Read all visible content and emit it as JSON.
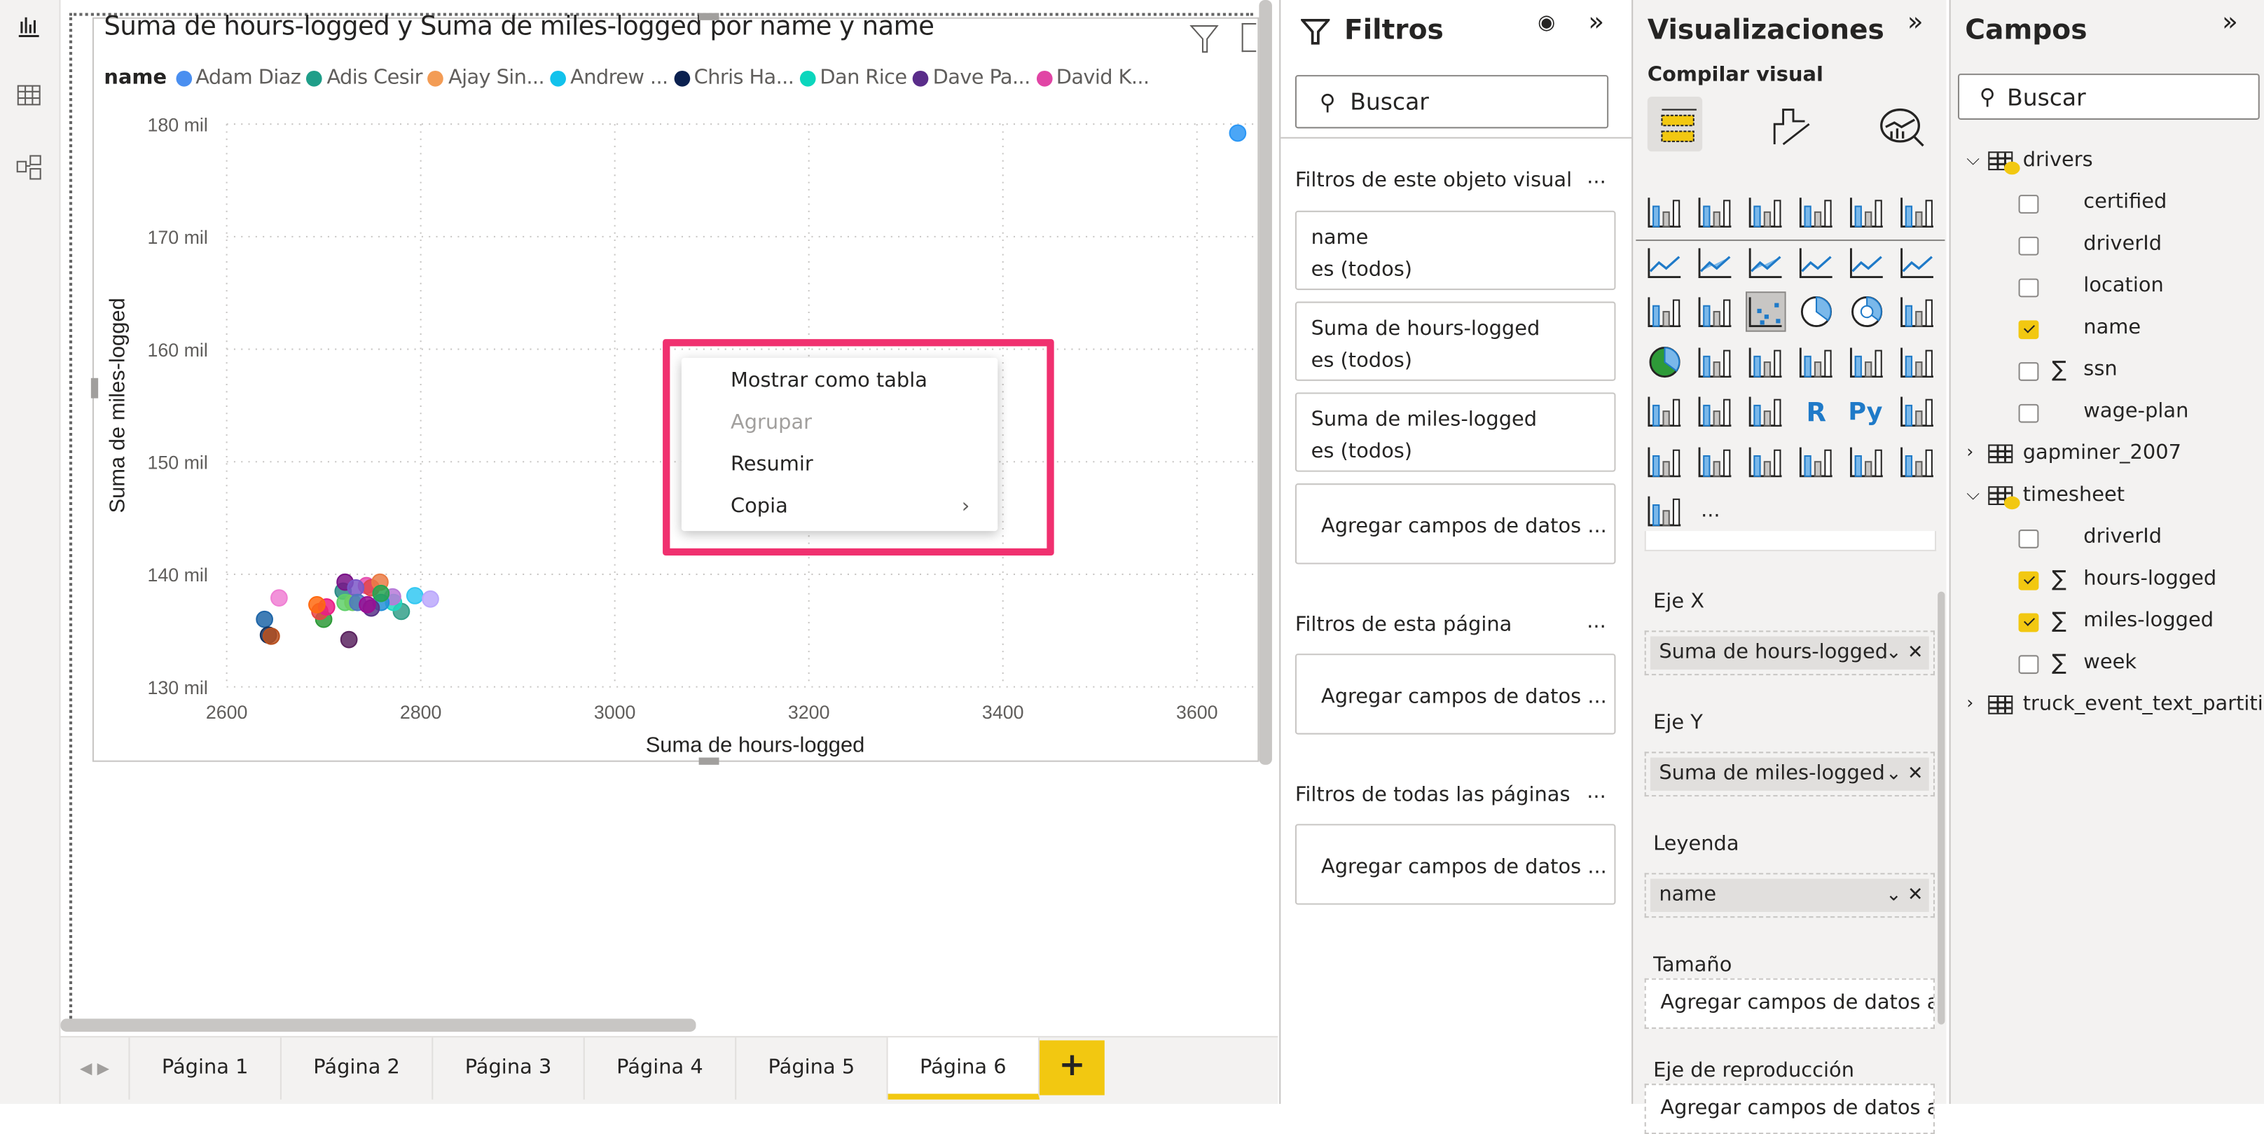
{
  "rail": {
    "icons": [
      "report-view-icon",
      "data-view-icon",
      "model-view-icon"
    ]
  },
  "visual": {
    "title": "Suma de hours-logged y Suma de miles-logged por name y name",
    "legend_title": "name",
    "legend": [
      {
        "label": "Adam Diaz",
        "color": "#4a8ff0"
      },
      {
        "label": "Adis Cesir",
        "color": "#1f9e89"
      },
      {
        "label": "Ajay Sin...",
        "color": "#f39c55"
      },
      {
        "label": "Andrew ...",
        "color": "#12c2ec"
      },
      {
        "label": "Chris Ha...",
        "color": "#0b2150"
      },
      {
        "label": "Dan Rice",
        "color": "#0bd6bd"
      },
      {
        "label": "Dave Pa...",
        "color": "#5a2d8a"
      },
      {
        "label": "David K...",
        "color": "#e145a5"
      }
    ]
  },
  "chart_data": {
    "type": "scatter",
    "title": "Suma de hours-logged y Suma de miles-logged por name y name",
    "xlabel": "Suma de hours-logged",
    "ylabel": "Suma de miles-logged",
    "xlim": [
      2600,
      3660
    ],
    "ylim": [
      130,
      180
    ],
    "xticks": [
      "2600",
      "2800",
      "3000",
      "3200",
      "3400",
      "3600"
    ],
    "xtick_values": [
      2600,
      2800,
      3000,
      3200,
      3400,
      3600
    ],
    "yticks": [
      "130 mil",
      "140 mil",
      "150 mil",
      "160 mil",
      "170 mil",
      "180 mil"
    ],
    "ytick_values": [
      130,
      140,
      150,
      160,
      170,
      180
    ],
    "y_unit": "mil",
    "grid": true,
    "legend_position": "top",
    "points": [
      {
        "x": 2654,
        "y": 137.9,
        "color": "#f07fd4"
      },
      {
        "x": 2639,
        "y": 136.0,
        "color": "#1f66a8"
      },
      {
        "x": 2643,
        "y": 134.6,
        "color": "#15305c"
      },
      {
        "x": 2646,
        "y": 134.5,
        "color": "#b8501e"
      },
      {
        "x": 2700,
        "y": 136.0,
        "color": "#2e9a38"
      },
      {
        "x": 2696,
        "y": 136.7,
        "color": "#e84545"
      },
      {
        "x": 2703,
        "y": 137.1,
        "color": "#ea1e86"
      },
      {
        "x": 2693,
        "y": 137.3,
        "color": "#ff6a10"
      },
      {
        "x": 2726,
        "y": 134.2,
        "color": "#5b2460"
      },
      {
        "x": 2720,
        "y": 138.5,
        "color": "#2a8a86"
      },
      {
        "x": 2722,
        "y": 139.3,
        "color": "#7a1388"
      },
      {
        "x": 2722,
        "y": 137.5,
        "color": "#5fd06a"
      },
      {
        "x": 2730,
        "y": 137.5,
        "color": "#6dcc63"
      },
      {
        "x": 2744,
        "y": 139.0,
        "color": "#e54fb0"
      },
      {
        "x": 2749,
        "y": 138.8,
        "color": "#e0464e"
      },
      {
        "x": 2758,
        "y": 139.3,
        "color": "#ea7c46"
      },
      {
        "x": 2733,
        "y": 138.8,
        "color": "#7a58c8"
      },
      {
        "x": 2735,
        "y": 137.5,
        "color": "#4f78c0"
      },
      {
        "x": 2780,
        "y": 136.7,
        "color": "#35a08a"
      },
      {
        "x": 2772,
        "y": 137.5,
        "color": "#22d8c0"
      },
      {
        "x": 2771,
        "y": 138.0,
        "color": "#b77ad8"
      },
      {
        "x": 2759,
        "y": 137.5,
        "color": "#2490d8"
      },
      {
        "x": 2749,
        "y": 137.0,
        "color": "#5a3488"
      },
      {
        "x": 2745,
        "y": 137.3,
        "color": "#9a0e94"
      },
      {
        "x": 2759,
        "y": 138.3,
        "color": "#25a550"
      },
      {
        "x": 2794,
        "y": 138.1,
        "color": "#33c8f2"
      },
      {
        "x": 2810,
        "y": 137.8,
        "color": "#bba8fc"
      },
      {
        "x": 3642,
        "y": 179.2,
        "color": "#2b97f5"
      }
    ]
  },
  "context_menu": {
    "items": [
      {
        "label": "Mostrar como tabla",
        "disabled": false
      },
      {
        "label": "Agrupar",
        "disabled": true
      },
      {
        "label": "Resumir",
        "disabled": false
      },
      {
        "label": "Copia",
        "disabled": false,
        "submenu": true
      }
    ]
  },
  "highlight_color": "#f0306f",
  "page_tabs": {
    "tabs": [
      "Página 1",
      "Página 2",
      "Página 3",
      "Página 4",
      "Página 5",
      "Página 6"
    ],
    "active": "Página 6",
    "add": "+"
  },
  "filters": {
    "title": "Filtros",
    "search_placeholder": "Buscar",
    "visual_section": "Filtros de este objeto visual",
    "visual_cards": [
      {
        "field": "name",
        "state": "es (todos)"
      },
      {
        "field": "Suma de hours-logged",
        "state": "es (todos)"
      },
      {
        "field": "Suma de miles-logged",
        "state": "es (todos)"
      }
    ],
    "add_fields": "Agregar campos de datos ...",
    "page_section": "Filtros de esta página",
    "all_section": "Filtros de todas las páginas",
    "more": "..."
  },
  "viz": {
    "title": "Visualizaciones",
    "subtitle": "Compilar visual",
    "more": "...",
    "wells": [
      {
        "label": "Eje X",
        "value": "Suma de hours-logged"
      },
      {
        "label": "Eje Y",
        "value": "Suma de miles-logged"
      },
      {
        "label": "Leyenda",
        "value": "name"
      },
      {
        "label": "Tamaño",
        "placeholder": "Agregar campos de datos a..."
      },
      {
        "label": "Eje de reproducción",
        "placeholder": "Agregar campos de datos a..."
      }
    ],
    "selected_visual": "scatter-chart",
    "accent": "#f2c811"
  },
  "fields": {
    "title": "Campos",
    "search_placeholder": "Buscar",
    "tables": [
      {
        "name": "drivers",
        "expanded": true,
        "in_use": true,
        "columns": [
          {
            "name": "certified",
            "checked": false,
            "sigma": false
          },
          {
            "name": "driverId",
            "checked": false,
            "sigma": false
          },
          {
            "name": "location",
            "checked": false,
            "sigma": false
          },
          {
            "name": "name",
            "checked": true,
            "sigma": false
          },
          {
            "name": "ssn",
            "checked": false,
            "sigma": true
          },
          {
            "name": "wage-plan",
            "checked": false,
            "sigma": false
          }
        ]
      },
      {
        "name": "gapminer_2007",
        "expanded": false,
        "in_use": false,
        "columns": []
      },
      {
        "name": "timesheet",
        "expanded": true,
        "in_use": true,
        "columns": [
          {
            "name": "driverId",
            "checked": false,
            "sigma": false
          },
          {
            "name": "hours-logged",
            "checked": true,
            "sigma": true
          },
          {
            "name": "miles-logged",
            "checked": true,
            "sigma": true
          },
          {
            "name": "week",
            "checked": false,
            "sigma": true
          }
        ]
      },
      {
        "name": "truck_event_text_partiti...",
        "expanded": false,
        "in_use": false,
        "columns": []
      }
    ]
  }
}
